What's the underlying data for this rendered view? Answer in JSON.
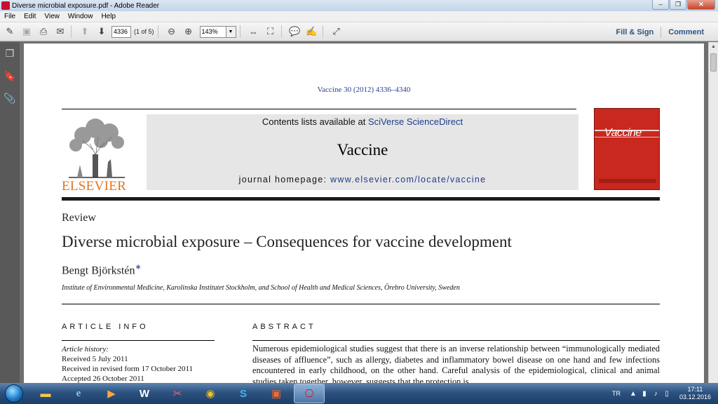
{
  "window": {
    "title": "Diverse microbial exposure.pdf - Adobe Reader"
  },
  "menu": [
    "File",
    "Edit",
    "View",
    "Window",
    "Help"
  ],
  "toolbar": {
    "page_value": "4336",
    "page_count": "(1 of 5)",
    "zoom_value": "143%",
    "fill_sign": "Fill & Sign",
    "comment": "Comment"
  },
  "document": {
    "running_head": "Vaccine 30 (2012) 4336–4340",
    "publisher_logo": "ELSEVIER",
    "contents_prefix": "Contents lists available at ",
    "contents_link": "SciVerse ScienceDirect",
    "journal_name": "Vaccine",
    "homepage_prefix": "journal homepage: ",
    "homepage_link": "www.elsevier.com/locate/vaccine",
    "cover_title": "Vaccine",
    "article_type": "Review",
    "title": "Diverse microbial exposure – Consequences for vaccine development",
    "author": "Bengt Björkstén",
    "author_mark": "∗",
    "affiliation": "Institute of Environmental Medicine, Karolinska Institutet Stockholm, and School of Health and Medical Sciences, Örebro University, Sweden",
    "article_info_head": "ARTICLE INFO",
    "abstract_head": "ABSTRACT",
    "history_head": "Article history:",
    "history": [
      "Received 5 July 2011",
      "Received in revised form 17 October 2011",
      "Accepted 26 October 2011"
    ],
    "abstract_text": "Numerous epidemiological studies suggest that there is an inverse relationship between “immunologically mediated diseases of affluence”, such as allergy, diabetes and inflammatory bowel disease on one hand and few infections encountered in early childhood, on the other hand. Careful analysis of the epidemiological, clinical and animal studies taken together, however, suggests that the protection is"
  },
  "taskbar": {
    "lang": "TR",
    "time": "17:11",
    "date": "03.12.2016"
  }
}
